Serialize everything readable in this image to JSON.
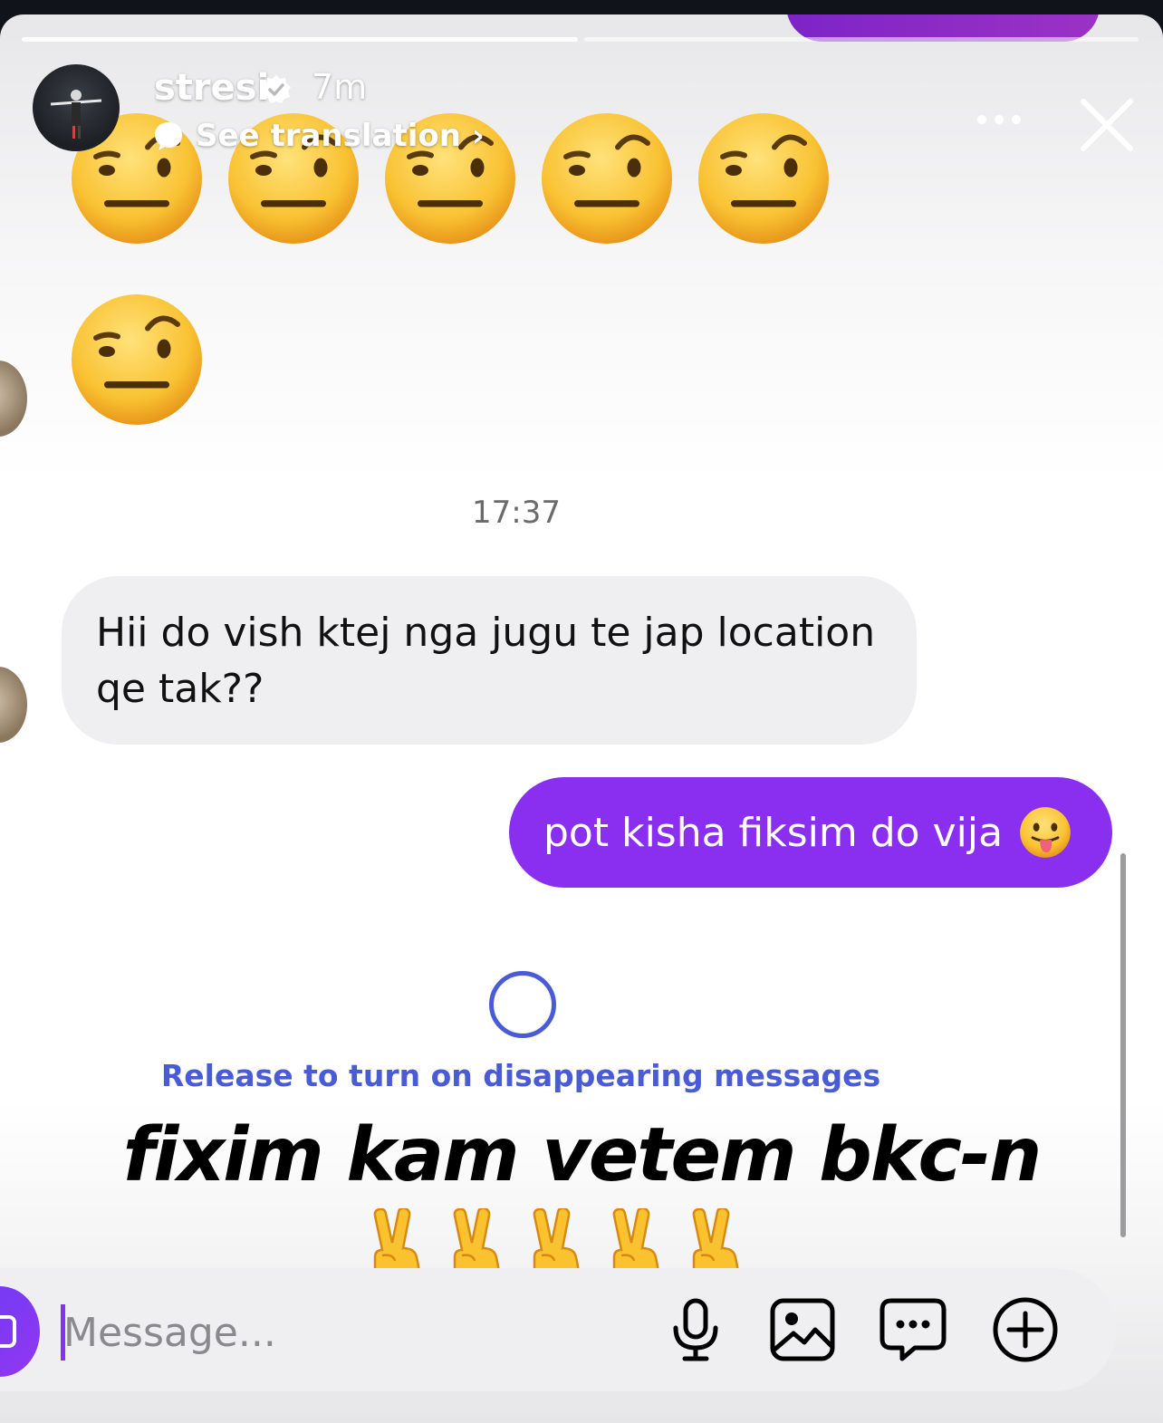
{
  "story": {
    "username": "stresi",
    "time_ago": "7m",
    "translate_label": "See translation",
    "progress_segments": [
      1,
      0.4
    ]
  },
  "colors": {
    "accent_purple": "#8a2ff0",
    "hint_blue": "#4a5bd6",
    "incoming_bubble": "#efeff1"
  },
  "chat": {
    "emoji_messages": [
      "face-with-raised-eyebrow-icon x6"
    ],
    "timestamp": "17:37",
    "incoming_message": "Hii do vish ktej nga jugu te jap location qe tak??",
    "outgoing_message": "pot kisha fiksim do vija",
    "release_hint": "Release to turn on disappearing messages"
  },
  "caption": {
    "text": "fixim kam vetem bkc-n",
    "emoji": "victory-hand-icon x5"
  },
  "composer": {
    "placeholder": "Message...",
    "value": "",
    "icons": [
      "camera-icon",
      "microphone-icon",
      "gallery-icon",
      "chat-icon",
      "add-icon"
    ]
  }
}
